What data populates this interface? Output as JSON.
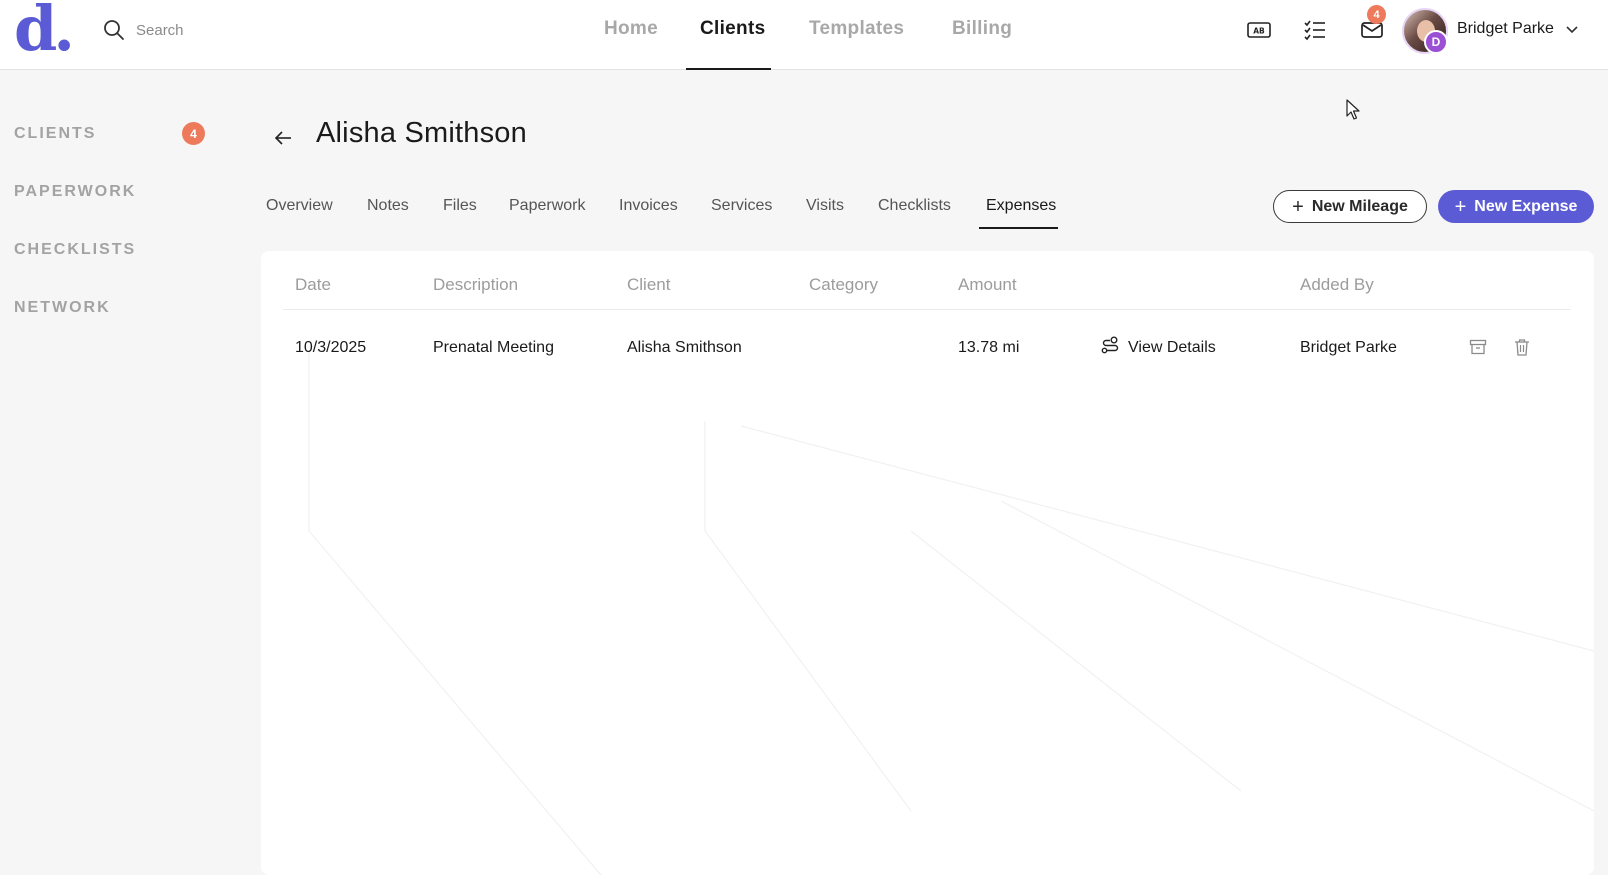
{
  "header": {
    "logo_letter": "d",
    "logo_dot": ".",
    "search_placeholder": "Search",
    "nav": [
      {
        "label": "Home"
      },
      {
        "label": "Clients"
      },
      {
        "label": "Templates"
      },
      {
        "label": "Billing"
      }
    ],
    "active_nav": "Clients",
    "language_icon_text": "AB",
    "mail_badge_count": "4",
    "avatar_badge_letter": "D",
    "user_name": "Bridget Parke"
  },
  "sidebar": {
    "items": [
      {
        "label": "CLIENTS"
      },
      {
        "label": "PAPERWORK"
      },
      {
        "label": "CHECKLISTS"
      },
      {
        "label": "NETWORK"
      }
    ],
    "clients_badge": "4"
  },
  "page": {
    "title": "Alisha Smithson",
    "tabs": [
      {
        "label": "Overview"
      },
      {
        "label": "Notes"
      },
      {
        "label": "Files"
      },
      {
        "label": "Paperwork"
      },
      {
        "label": "Invoices"
      },
      {
        "label": "Services"
      },
      {
        "label": "Visits"
      },
      {
        "label": "Checklists"
      },
      {
        "label": "Expenses"
      }
    ],
    "active_tab": "Expenses",
    "new_mileage_label": "New Mileage",
    "new_expense_label": "New Expense"
  },
  "table": {
    "columns": [
      "Date",
      "Description",
      "Client",
      "Category",
      "Amount",
      "Added By"
    ],
    "rows": [
      {
        "date": "10/3/2025",
        "description": "Prenatal Meeting",
        "client": "Alisha Smithson",
        "category": "",
        "amount": "13.78 mi",
        "details_label": "View Details",
        "added_by": "Bridget Parke"
      }
    ]
  },
  "colors": {
    "accent": "#5b5bd6",
    "badge": "#ee7a5c",
    "avatar_badge": "#9a4fd4"
  }
}
